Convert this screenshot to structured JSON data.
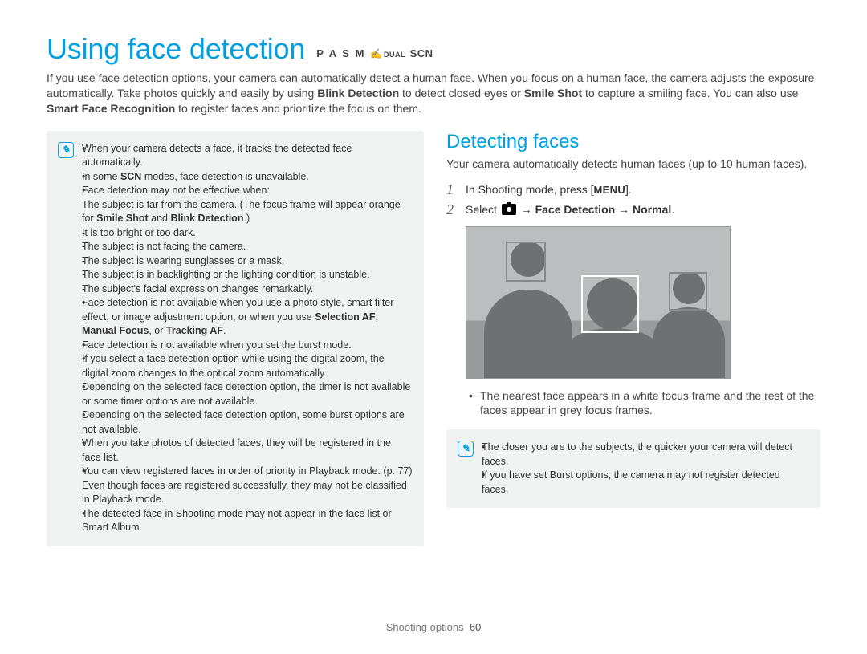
{
  "title": "Using face detection",
  "modes_prefix": "P A S M",
  "modes_dual": "DUAL",
  "modes_scn": "SCN",
  "intro_1": "If you use face detection options, your camera can automatically detect a human face. When you focus on a human face, the camera adjusts the exposure automatically. Take photos quickly and easily by using ",
  "intro_blink": "Blink Detection",
  "intro_2": " to detect closed eyes or ",
  "intro_smile": "Smile Shot",
  "intro_3": " to capture a smiling face. You can also use ",
  "intro_smart": "Smart Face Recognition",
  "intro_4": " to register faces and prioritize the focus on them.",
  "tip_icon_glyph": "✎",
  "left_tips": {
    "b1": "When your camera detects a face, it tracks the detected face automatically.",
    "b2_a": "In some ",
    "b2_scn": "SCN",
    "b2_b": " modes, face detection is unavailable.",
    "b3": "Face detection may not be effective when:",
    "b3_sub1_a": "The subject is far from the camera. (The focus frame will appear orange for ",
    "b3_sub1_b": "Smile Shot",
    "b3_sub1_c": " and ",
    "b3_sub1_d": "Blink Detection",
    "b3_sub1_e": ".)",
    "b3_sub2": "It is too bright or too dark.",
    "b3_sub3": "The subject is not facing the camera.",
    "b3_sub4": "The subject is wearing sunglasses or a mask.",
    "b3_sub5": "The subject is in backlighting or the lighting condition is unstable.",
    "b3_sub6": "The subject's facial expression changes remarkably.",
    "b4_a": "Face detection is not available when you use a photo style, smart filter effect, or image adjustment option, or when you use ",
    "b4_b": "Selection AF",
    "b4_c": ", ",
    "b4_d": "Manual Focus",
    "b4_e": ", or ",
    "b4_f": "Tracking AF",
    "b4_g": ".",
    "b5": "Face detection is not available when you set the burst mode.",
    "b6": "If you select a face detection option while using the digital zoom, the digital zoom changes to the optical zoom automatically.",
    "b7": "Depending on the selected face detection option, the timer is not available or some timer options are not available.",
    "b8": "Depending on the selected face detection option, some burst options are not available.",
    "b9": "When you take photos of detected faces, they will be registered in the face list.",
    "b10": "You can view registered faces in order of priority in Playback mode. (p. 77) Even though faces are registered successfully, they may not be classified in Playback mode.",
    "b11": "The detected face in Shooting mode may not appear in the face list or Smart Album."
  },
  "right": {
    "header": "Detecting faces",
    "subtext": "Your camera automatically detects human faces (up to 10 human faces).",
    "step1_a": "In Shooting mode, press [",
    "step1_menu": "MENU",
    "step1_b": "].",
    "step2_a": "Select ",
    "step2_b": " → ",
    "step2_c": "Face Detection",
    "step2_d": " → ",
    "step2_e": "Normal",
    "step2_f": ".",
    "result": "The nearest face appears in a white focus frame and the rest of the faces appear in grey focus frames.",
    "tip1": "The closer you are to the subjects, the quicker your camera will detect faces.",
    "tip2": "If you have set Burst options, the camera may not register detected faces."
  },
  "footer_section": "Shooting options",
  "footer_page": "60"
}
